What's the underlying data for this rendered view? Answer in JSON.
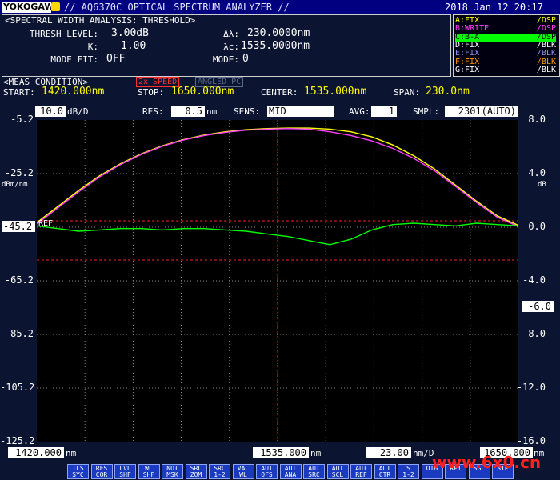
{
  "header": {
    "logo": "YOKOGAWA",
    "title": "// AQ6370C OPTICAL SPECTRUM ANALYZER //",
    "datetime": "2018 Jan 12 20:17"
  },
  "analysis": {
    "heading": "<SPECTRAL WIDTH ANALYSIS: THRESHOLD>",
    "thresh_label": "THRESH LEVEL:",
    "thresh_value": "3.00dB",
    "k_label": "K:",
    "k_value": "1.00",
    "modefit_label": "MODE FIT:",
    "modefit_value": "OFF",
    "dl_label": "Δλ:",
    "dl_value": "230.0000nm",
    "lc_label": "λc:",
    "lc_value": "1535.0000nm",
    "mode_label": "MODE:",
    "mode_value": "0"
  },
  "traces": [
    {
      "name": "A:FIX",
      "mode": "/DSP",
      "color": "#ffff00",
      "active": false
    },
    {
      "name": "B:WRITE",
      "mode": "/DSP",
      "color": "#ff40ff",
      "active": false
    },
    {
      "name": "C:B-A",
      "mode": "/DSP",
      "color": "#00ff00",
      "active": true
    },
    {
      "name": "D:FIX",
      "mode": "/BLK",
      "color": "#ffffff",
      "active": false
    },
    {
      "name": "E:FIX",
      "mode": "/BLK",
      "color": "#9090ff",
      "active": false
    },
    {
      "name": "F:FIX",
      "mode": "/BLK",
      "color": "#ff9900",
      "active": false
    },
    {
      "name": "G:FIX",
      "mode": "/BLK",
      "color": "#ffffff",
      "active": false
    }
  ],
  "meas": {
    "heading": "<MEAS CONDITION>",
    "speed": "2x SPEED",
    "angled": "ANGLED PC",
    "start_label": "START:",
    "start_value": "1420.000nm",
    "stop_label": "STOP:",
    "stop_value": "1650.000nm",
    "center_label": "CENTER:",
    "center_value": "1535.000nm",
    "span_label": "SPAN:",
    "span_value": "230.0nm"
  },
  "status": {
    "scale_value": "10.0",
    "scale_unit": "dB/D",
    "res_label": "RES:",
    "res_value": "0.5",
    "res_unit": "nm",
    "sens_label": "SENS:",
    "sens_value": "MID",
    "avg_label": "AVG:",
    "avg_value": "1",
    "smpl_label": "SMPL:",
    "smpl_value": "2301(AUTO)"
  },
  "chart_data": {
    "type": "line",
    "xlim": [
      1420.0,
      1650.0
    ],
    "ylim_left": [
      -125.2,
      -5.2
    ],
    "ylim_right": [
      -16.0,
      8.0
    ],
    "left_unit": "dBm/nm",
    "right_unit": "dB",
    "left_ticks": [
      "-5.2",
      "-25.2",
      "-45.2",
      "-65.2",
      "-85.2",
      "-105.2",
      "-125.2"
    ],
    "right_ticks": [
      "8.0",
      "4.0",
      "0.0",
      "-4.0",
      "-8.0",
      "-12.0",
      "-16.0"
    ],
    "ref_level": "-45.2",
    "ref_label": "REF",
    "right_marker": "-6.0",
    "grid": true,
    "series": [
      {
        "trace": "A",
        "color": "#ffff00",
        "x": [
          1420,
          1430,
          1440,
          1450,
          1460,
          1470,
          1480,
          1490,
          1500,
          1510,
          1520,
          1530,
          1540,
          1550,
          1560,
          1570,
          1580,
          1590,
          1600,
          1610,
          1620,
          1630,
          1640,
          1650
        ],
        "y": [
          -43.5,
          -37.5,
          -31.5,
          -26.0,
          -21.5,
          -17.8,
          -14.8,
          -12.5,
          -10.8,
          -9.6,
          -8.8,
          -8.4,
          -8.2,
          -8.2,
          -8.6,
          -9.6,
          -11.5,
          -14.5,
          -18.5,
          -23.5,
          -29.5,
          -35.5,
          -41.0,
          -44.5
        ]
      },
      {
        "trace": "B",
        "color": "#ff40ff",
        "x": [
          1420,
          1430,
          1440,
          1450,
          1460,
          1470,
          1480,
          1490,
          1500,
          1510,
          1520,
          1530,
          1540,
          1550,
          1560,
          1570,
          1580,
          1590,
          1600,
          1610,
          1620,
          1630,
          1640,
          1650
        ],
        "y": [
          -44.0,
          -38.0,
          -32.0,
          -26.4,
          -21.8,
          -18.0,
          -15.0,
          -12.7,
          -11.0,
          -9.8,
          -9.0,
          -8.6,
          -8.4,
          -8.6,
          -9.6,
          -11.0,
          -13.0,
          -15.8,
          -19.5,
          -24.2,
          -30.0,
          -36.0,
          -41.5,
          -45.0
        ]
      },
      {
        "trace": "C",
        "color": "#00ff00",
        "axis": "right",
        "x": [
          1420,
          1430,
          1440,
          1450,
          1460,
          1470,
          1480,
          1490,
          1500,
          1510,
          1520,
          1530,
          1540,
          1550,
          1560,
          1570,
          1580,
          1590,
          1600,
          1610,
          1620,
          1630,
          1640,
          1650
        ],
        "y": [
          0.1,
          -0.1,
          -0.3,
          -0.2,
          -0.1,
          -0.1,
          -0.2,
          -0.1,
          -0.1,
          -0.2,
          -0.3,
          -0.5,
          -0.7,
          -1.0,
          -1.3,
          -0.9,
          -0.2,
          0.2,
          0.3,
          0.2,
          0.1,
          0.3,
          0.2,
          0.1
        ]
      }
    ],
    "bottom_start": "1420.000",
    "bottom_start_unit": "nm",
    "bottom_center": "1535.000",
    "bottom_center_unit": "nm",
    "bottom_scale": "23.00",
    "bottom_scale_unit": "nm/D",
    "bottom_stop": "1650.000",
    "bottom_stop_unit": "nm"
  },
  "softkeys": [
    [
      "TLS",
      "SYC"
    ],
    [
      "RES",
      "COR"
    ],
    [
      "LVL",
      "SHF"
    ],
    [
      "WL",
      "SHF"
    ],
    [
      "NOI",
      "MSK"
    ],
    [
      "SRC",
      "ZOM"
    ],
    [
      "SRC",
      "1-2"
    ],
    [
      "VAC",
      "WL"
    ],
    [
      "AUT",
      "OFS"
    ],
    [
      "AUT",
      "ANA"
    ],
    [
      "AUT",
      "SRC"
    ],
    [
      "AUT",
      "SCL"
    ],
    [
      "AUT",
      "REF"
    ],
    [
      "AUT",
      "CTR"
    ],
    [
      "S",
      "1-2"
    ],
    [
      "",
      "OTH"
    ],
    [
      "",
      "RPT"
    ],
    [
      "",
      "SGL"
    ],
    [
      "",
      "STP"
    ]
  ],
  "watermark": "www.6x0.cn"
}
